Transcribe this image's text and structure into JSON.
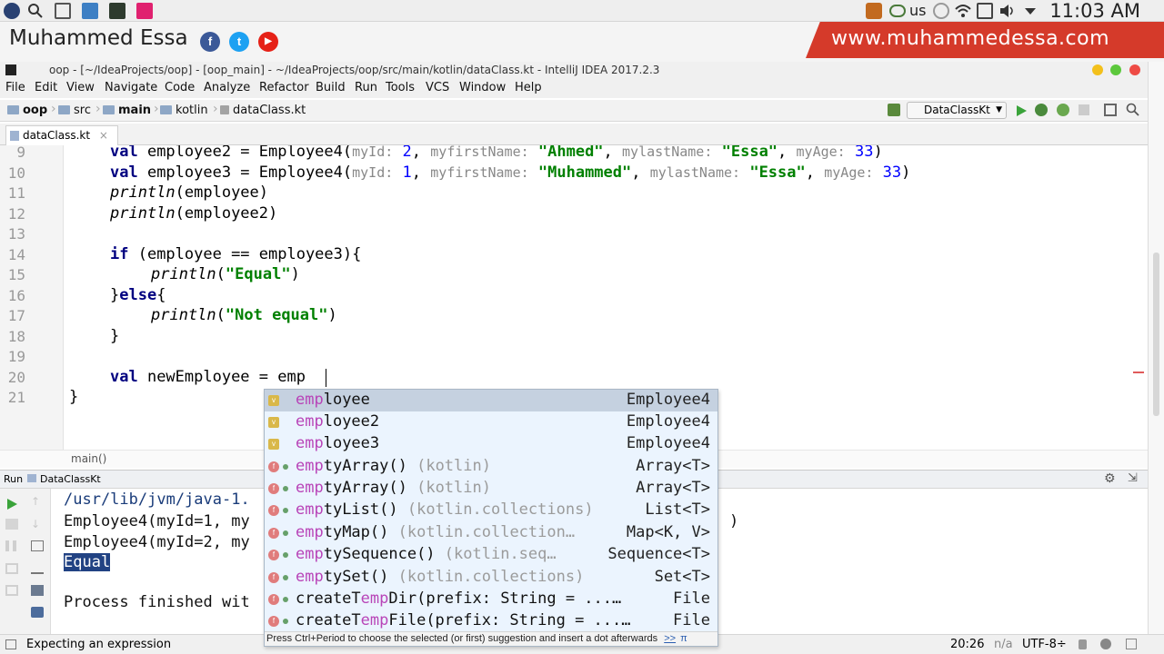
{
  "os": {
    "clock": "11:03 AM",
    "keyboard": "us"
  },
  "banner": {
    "name": "Muhammed Essa",
    "url": "www.muhammedessa.com",
    "facebook": "f",
    "twitter": "t",
    "youtube": "▶"
  },
  "window": {
    "title": "oop - [~/IdeaProjects/oop] - [oop_main] - ~/IdeaProjects/oop/src/main/kotlin/dataClass.kt - IntelliJ IDEA 2017.2.3"
  },
  "menu": [
    "File",
    "Edit",
    "View",
    "Navigate",
    "Code",
    "Analyze",
    "Refactor",
    "Build",
    "Run",
    "Tools",
    "VCS",
    "Window",
    "Help"
  ],
  "breadcrumbs": [
    "oop",
    "src",
    "main",
    "kotlin",
    "dataClass.kt"
  ],
  "run_config": "DataClassKt",
  "tab": {
    "label": "dataClass.kt",
    "close": "×"
  },
  "editor": {
    "line_numbers": [
      "9",
      "10",
      "11",
      "12",
      "13",
      "14",
      "15",
      "16",
      "17",
      "18",
      "19",
      "20",
      "21"
    ],
    "l9": {
      "kw": "val",
      "a": " employee2 = Employee4(",
      "h1": "myId:",
      "n1": "2",
      "h2": "myfirstName:",
      "s1": "\"Ahmed\"",
      "h3": "mylastName:",
      "s2": "\"Essa\"",
      "h4": "myAge:",
      "n2": "33",
      "end": ")"
    },
    "l10": {
      "kw": "val",
      "a": " employee3 = Employee4(",
      "h1": "myId:",
      "n1": "1",
      "h2": "myfirstName:",
      "s1": "\"Muhammed\"",
      "h3": "mylastName:",
      "s2": "\"Essa\"",
      "h4": "myAge:",
      "n2": "33",
      "end": ")"
    },
    "l11": {
      "fn": "println",
      "rest": "(employee)"
    },
    "l12": {
      "fn": "println",
      "rest": "(employee2)"
    },
    "l14": {
      "kw": "if",
      "rest": " (employee == employee3){"
    },
    "l15": {
      "fn": "println",
      "open": "(",
      "str": "\"Equal\"",
      "close": ")"
    },
    "l16": {
      "a": "}",
      "kw": "else",
      "b": "{"
    },
    "l17": {
      "fn": "println",
      "open": "(",
      "str": "\"Not equal\"",
      "close": ")"
    },
    "l18": "}",
    "l20": {
      "kw": "val",
      "rest": " newEmployee = emp"
    },
    "l21": "}"
  },
  "code_breadcrumb": "main()",
  "run_panel": {
    "label": "Run",
    "config": "DataClassKt",
    "lines": [
      "/usr/lib/jvm/java-1.",
      "Employee4(myId=1, my",
      "Employee4(myId=2, my",
      "Equal",
      "Process finished wit"
    ],
    "tail": ")"
  },
  "completion": {
    "items": [
      {
        "icon": "v",
        "match": "emp",
        "name": "loyee",
        "pkg": "",
        "type": "Employee4"
      },
      {
        "icon": "v",
        "match": "emp",
        "name": "loyee2",
        "pkg": "",
        "type": "Employee4"
      },
      {
        "icon": "v",
        "match": "emp",
        "name": "loyee3",
        "pkg": "",
        "type": "Employee4"
      },
      {
        "icon": "f",
        "match": "emp",
        "name": "tyArray()",
        "pkg": "(kotlin)",
        "type": "Array<T>"
      },
      {
        "icon": "f",
        "match": "emp",
        "name": "tyArray()",
        "pkg": "(kotlin)",
        "type": "Array<T>"
      },
      {
        "icon": "f",
        "match": "emp",
        "name": "tyList()",
        "pkg": "(kotlin.collections)",
        "type": "List<T>"
      },
      {
        "icon": "f",
        "match": "emp",
        "name": "tyMap()",
        "pkg": "(kotlin.collection…",
        "type": "Map<K, V>"
      },
      {
        "icon": "f",
        "match": "emp",
        "name": "tySequence()",
        "pkg": "(kotlin.seq…",
        "type": "Sequence<T>"
      },
      {
        "icon": "f",
        "match": "emp",
        "name": "tySet()",
        "pkg": "(kotlin.collections)",
        "type": "Set<T>"
      },
      {
        "icon": "f",
        "pre": "createT",
        "match": "emp",
        "name": "Dir(prefix: String = ...…",
        "pkg": "",
        "type": "File"
      },
      {
        "icon": "f",
        "pre": "createT",
        "match": "emp",
        "name": "File(prefix: String = ...…",
        "pkg": "",
        "type": "File"
      }
    ],
    "footer": "Press Ctrl+Period to choose the selected (or first) suggestion and insert a dot afterwards",
    "footer_link": ">>",
    "footer_pi": "π"
  },
  "status": {
    "message": "Expecting an expression",
    "position": "20:26",
    "na": "n/a",
    "encoding": "UTF-8÷"
  }
}
